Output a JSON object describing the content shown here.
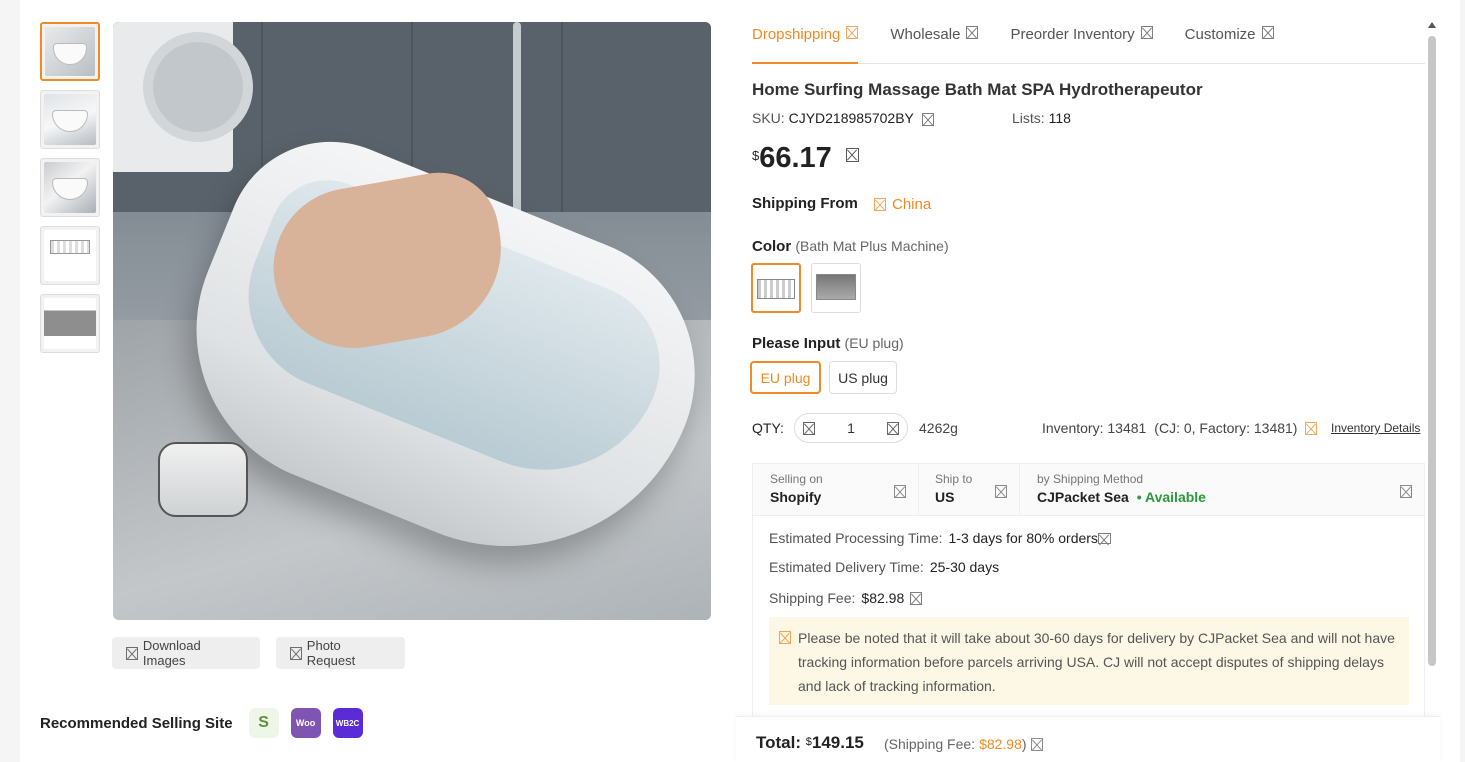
{
  "tabs": [
    {
      "label": "Dropshipping",
      "active": true
    },
    {
      "label": "Wholesale",
      "active": false
    },
    {
      "label": "Preorder Inventory",
      "active": false
    },
    {
      "label": "Customize",
      "active": false
    }
  ],
  "product": {
    "title": "Home Surfing Massage Bath Mat SPA Hydrotherapeutor",
    "sku_label": "SKU:",
    "sku": "CJYD218985702BY",
    "lists_label": "Lists:",
    "lists": "118",
    "currency": "$",
    "price": "66.17"
  },
  "shipping_from": {
    "label": "Shipping From",
    "country": "China"
  },
  "color": {
    "label": "Color",
    "selected": "(Bath Mat Plus Machine)"
  },
  "plug": {
    "label": "Please Input",
    "selected": "(EU plug)",
    "options": [
      "EU plug",
      "US plug"
    ]
  },
  "qty": {
    "label": "QTY:",
    "value": "1",
    "weight": "4262g",
    "inventory": "Inventory: 13481",
    "inventory_detail": "(CJ: 0, Factory: 13481)",
    "inventory_link": "Inventory Details"
  },
  "shipping": {
    "selling_on_label": "Selling on",
    "selling_on": "Shopify",
    "ship_to_label": "Ship to",
    "ship_to": "US",
    "method_label": "by Shipping Method",
    "method": "CJPacket Sea",
    "availability": "• Available",
    "processing_label": "Estimated Processing Time:",
    "processing": "1-3 days for 80% orders",
    "delivery_label": "Estimated Delivery Time:",
    "delivery": "25-30 days",
    "fee_label": "Shipping Fee:",
    "fee": "$82.98",
    "notice": "Please be noted that it will take about 30-60 days for delivery by CJPacket Sea and will not have tracking information before parcels arriving USA. CJ will not accept disputes of shipping delays and lack of tracking information."
  },
  "total": {
    "label": "Total:",
    "currency": "$",
    "amount": "149.15",
    "fee_prefix": "(Shipping Fee:",
    "fee": "$82.98",
    "fee_suffix": ")"
  },
  "image_actions": {
    "download": "Download Images",
    "photo_request": "Photo Request"
  },
  "recommended": {
    "label": "Recommended Selling Site",
    "sites": [
      {
        "name": "shopify-icon",
        "glyph": "S"
      },
      {
        "name": "woocommerce-icon",
        "glyph": "Woo"
      },
      {
        "name": "wb2c-icon",
        "glyph": "WB2C"
      }
    ]
  },
  "colors": {
    "accent": "#f08a24",
    "available": "#2c9a3c",
    "notice_bg": "#fdf7e6"
  }
}
